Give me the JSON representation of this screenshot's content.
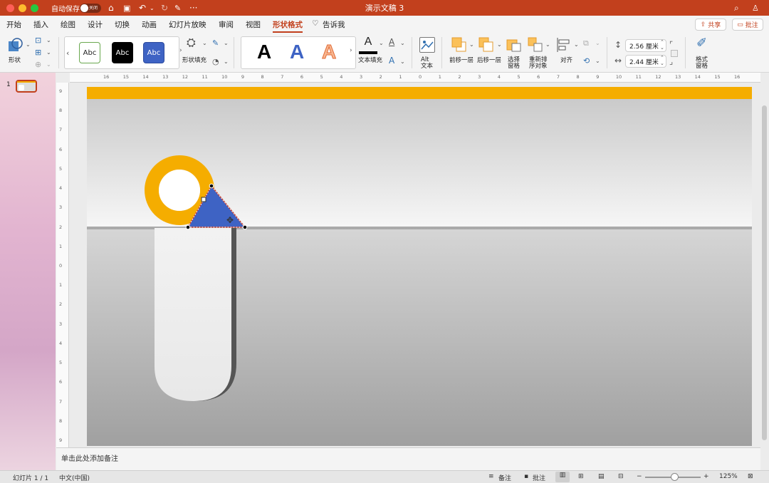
{
  "titlebar": {
    "autosave_label": "自动保存",
    "autosave_state": "关闭",
    "doc_title": "演示文稿 3",
    "more": "···"
  },
  "tabs": [
    "开始",
    "插入",
    "绘图",
    "设计",
    "切换",
    "动画",
    "幻灯片放映",
    "审阅",
    "视图",
    "形状格式",
    "告诉我"
  ],
  "active_tab": "形状格式",
  "actions": {
    "share": "共享",
    "comments": "批注"
  },
  "ribbon": {
    "shapes_label": "形状",
    "style_samples": [
      "Abc",
      "Abc",
      "Abc"
    ],
    "shape_fill_label": "形状填充",
    "wordart_samples": [
      "A",
      "A",
      "A"
    ],
    "text_fill_label": "文本填充",
    "alt_text_label": [
      "Alt",
      "文本"
    ],
    "bring_forward_label": "前移一层",
    "send_backward_label": "后移一层",
    "selection_pane_label": [
      "选择",
      "窗格"
    ],
    "reorder_label": [
      "重新排",
      "序对象"
    ],
    "align_label": "对齐",
    "height_value": "2.56 厘米",
    "width_value": "2.44 厘米",
    "format_pane_label": [
      "格式",
      "窗格"
    ]
  },
  "thumbnail": {
    "number": "1"
  },
  "ruler": {
    "h_ticks": [
      "16",
      "15",
      "14",
      "13",
      "12",
      "11",
      "10",
      "9",
      "8",
      "7",
      "6",
      "5",
      "4",
      "3",
      "2",
      "1",
      "0",
      "1",
      "2",
      "3",
      "4",
      "5",
      "6",
      "7",
      "8",
      "9",
      "10",
      "11",
      "12",
      "13",
      "14",
      "15",
      "16"
    ],
    "v_ticks": [
      "9",
      "8",
      "7",
      "6",
      "5",
      "4",
      "3",
      "2",
      "1",
      "0",
      "1",
      "2",
      "3",
      "4",
      "5",
      "6",
      "7",
      "8",
      "9"
    ]
  },
  "notes_placeholder": "单击此处添加备注",
  "status": {
    "slide_info": "幻灯片 1 / 1",
    "language": "中文(中国)",
    "notes_btn": "备注",
    "comments_btn": "批注",
    "zoom_level": "125%"
  },
  "colors": {
    "brand": "#c2401d",
    "orange": "#f5ad00",
    "triangle_fill": "#3e63c4",
    "triangle_stroke": "#c0392b"
  }
}
